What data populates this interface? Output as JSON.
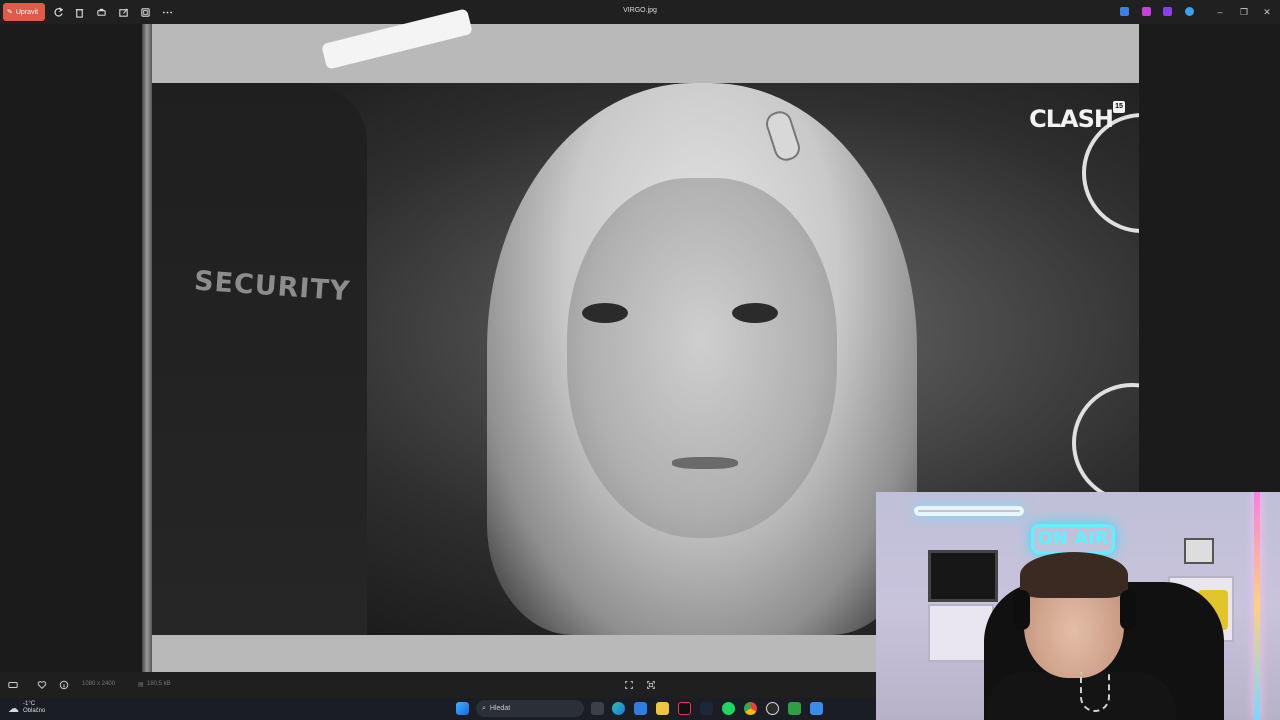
{
  "titlebar": {
    "edit_label": "Upravit",
    "file_title": "VIRGO.jpg",
    "window_controls": [
      "minimize",
      "restore",
      "close"
    ],
    "toolbar_icons": [
      "rotate-icon",
      "delete-icon",
      "print-icon",
      "share-icon",
      "crop-icon",
      "more-icon"
    ],
    "app_icons": [
      "app-icon-blue",
      "app-icon-purple",
      "app-icon-violet",
      "onedrive-icon"
    ]
  },
  "photo": {
    "watermark": "CLASH",
    "watermark_badge": "15",
    "shirt_text": "SECURITY"
  },
  "viewer_bar": {
    "dimensions": "1080 x 2400",
    "file_size": "180,5 kB"
  },
  "taskbar": {
    "weather_temp": "-1°C",
    "weather_desc": "Oblačno",
    "search_placeholder": "Hledat",
    "pinned_apps": [
      "windows-start",
      "search",
      "task-view",
      "edge",
      "store",
      "file-explorer",
      "tiktok",
      "steam",
      "spotify",
      "chrome",
      "obs",
      "vscode-like",
      "photos"
    ]
  },
  "webcam": {
    "neon_sign": "ON AIR"
  },
  "colors": {
    "edit_button": "#e05a4c",
    "titlebar": "#202020",
    "taskbar": "#1a1d24",
    "neon": "#5ff1ff"
  }
}
